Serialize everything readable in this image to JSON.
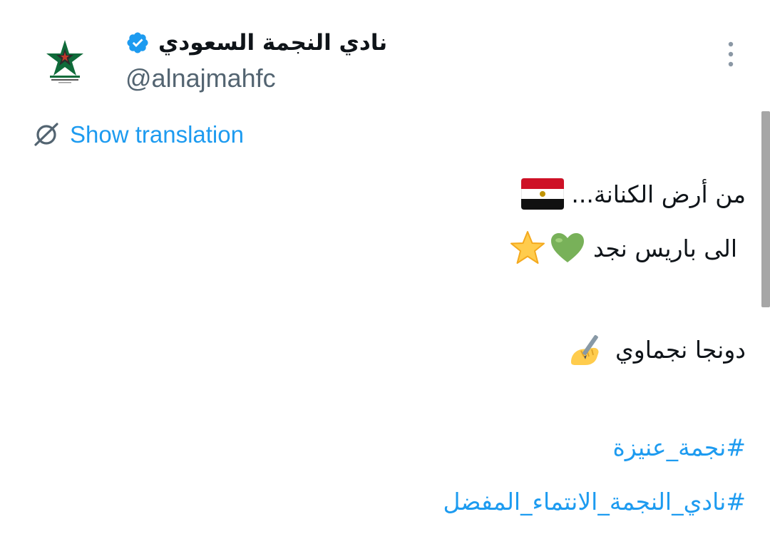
{
  "author": {
    "display_name": "نادي النجمة السعودي",
    "handle": "@alnajmahfc",
    "verified": true
  },
  "translate_label": "Show translation",
  "tweet": {
    "line1": "من أرض الكنانة...",
    "line1_emoji": "egypt-flag",
    "line2": "الى باريس نجد",
    "line2_emoji": [
      "green-heart",
      "star"
    ],
    "line3": "دونجا نجماوي",
    "line3_emoji": "writing-hand",
    "hashtags": [
      "#نجمة_عنيزة",
      "#نادي_النجمة_الانتماء_المفضل"
    ]
  },
  "colors": {
    "link": "#1d9bf0",
    "text": "#0f1419",
    "secondary": "#536471",
    "brand_green": "#0f6b3a"
  }
}
